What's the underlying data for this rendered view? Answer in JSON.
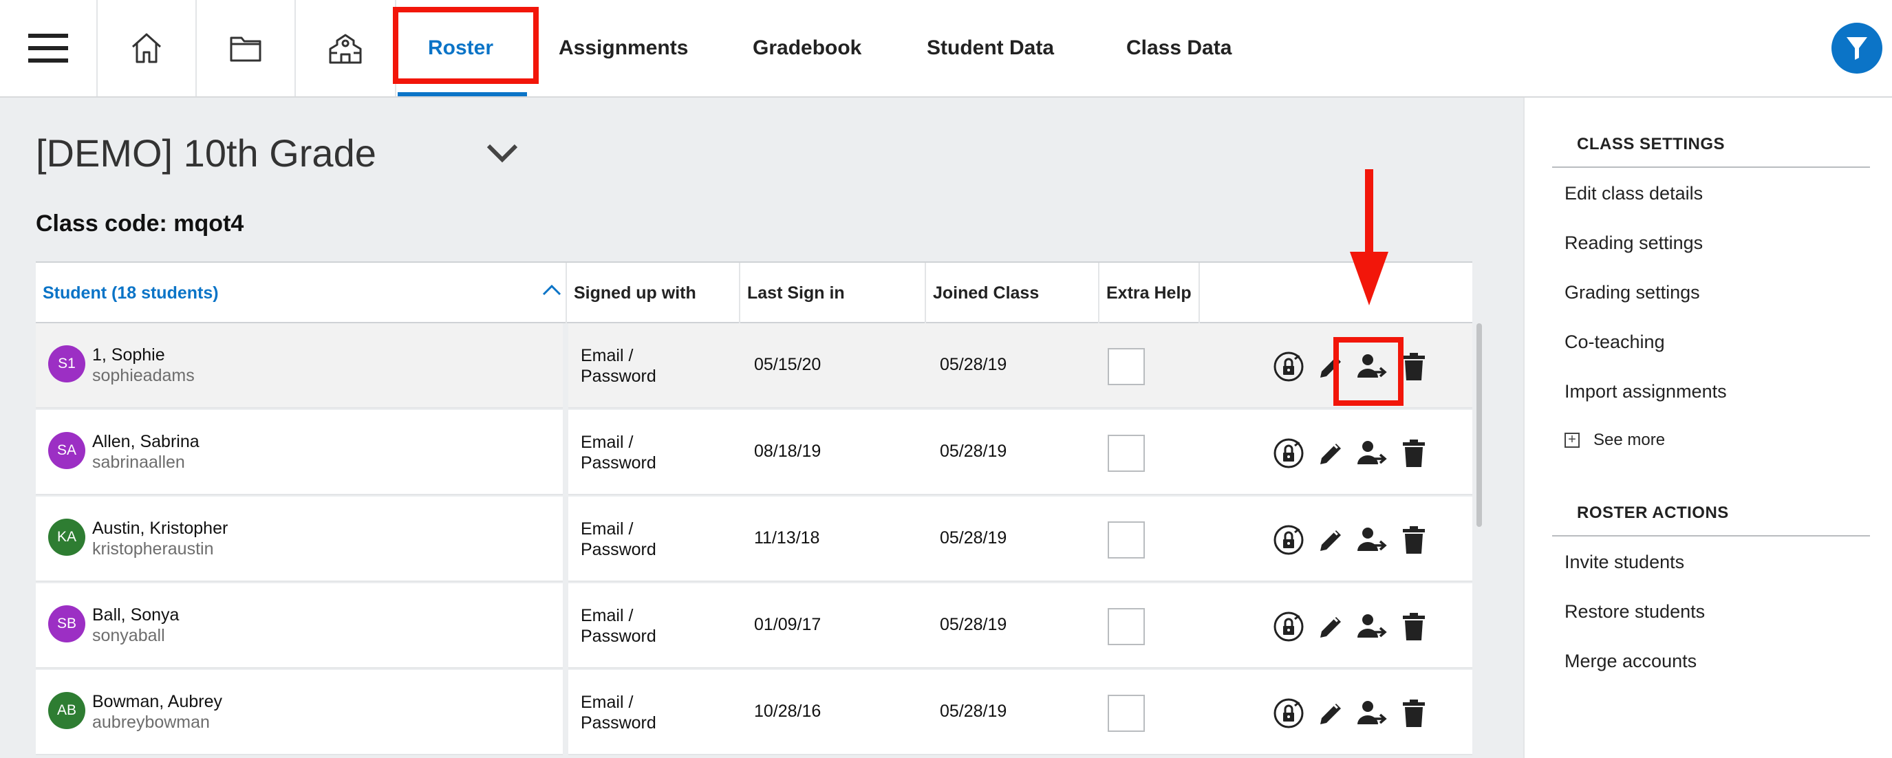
{
  "nav": {
    "tabs": [
      {
        "label": "Roster",
        "active": true
      },
      {
        "label": "Assignments"
      },
      {
        "label": "Gradebook"
      },
      {
        "label": "Student Data"
      },
      {
        "label": "Class Data"
      }
    ],
    "icons": [
      "menu-icon",
      "home-icon",
      "folder-icon",
      "school-icon",
      "filter-icon"
    ]
  },
  "main": {
    "class_title": "[DEMO] 10th Grade",
    "class_code": "Class code: mqot4"
  },
  "table": {
    "headers": [
      "Student (18 students)",
      "Signed up with",
      "Last Sign in",
      "Joined Class",
      "Extra Help"
    ],
    "rows": [
      {
        "initials": "S1",
        "avatar_color": "#9c2fc4",
        "name": "1, Sophie",
        "username": "sophieadams",
        "signup": "Email / Password",
        "last_sign_in": "05/15/20",
        "joined": "05/28/19"
      },
      {
        "initials": "SA",
        "avatar_color": "#9c2fc4",
        "name": "Allen, Sabrina",
        "username": "sabrinaallen",
        "signup": "Email / Password",
        "last_sign_in": "08/18/19",
        "joined": "05/28/19"
      },
      {
        "initials": "KA",
        "avatar_color": "#2e7d32",
        "name": "Austin, Kristopher",
        "username": "kristopheraustin",
        "signup": "Email / Password",
        "last_sign_in": "11/13/18",
        "joined": "05/28/19"
      },
      {
        "initials": "SB",
        "avatar_color": "#9c2fc4",
        "name": "Ball, Sonya",
        "username": "sonyaball",
        "signup": "Email / Password",
        "last_sign_in": "01/09/17",
        "joined": "05/28/19"
      },
      {
        "initials": "AB",
        "avatar_color": "#2e7d32",
        "name": "Bowman, Aubrey",
        "username": "aubreybowman",
        "signup": "Email / Password",
        "last_sign_in": "10/28/16",
        "joined": "05/28/19"
      }
    ],
    "row_actions": [
      "reset-password-icon",
      "edit-icon",
      "move-student-icon",
      "delete-icon"
    ]
  },
  "right_panel": {
    "class_settings_heading": "CLASS SETTINGS",
    "class_settings": [
      "Edit class details",
      "Reading settings",
      "Grading settings",
      "Co-teaching",
      "Import assignments"
    ],
    "see_more": "See more",
    "roster_actions_heading": "ROSTER ACTIONS",
    "roster_actions": [
      "Invite students",
      "Restore students",
      "Merge accounts"
    ]
  },
  "colors": {
    "accent": "#0b74c7",
    "highlight": "#f2160a",
    "background": "#eceef0"
  }
}
